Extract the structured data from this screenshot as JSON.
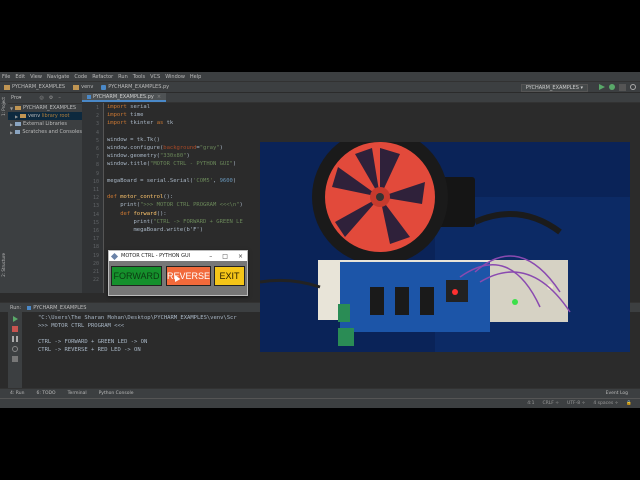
{
  "menu": [
    "File",
    "Edit",
    "View",
    "Navigate",
    "Code",
    "Refactor",
    "Run",
    "Tools",
    "VCS",
    "Window",
    "Help"
  ],
  "navbar": {
    "project": "PYCHARM_EXAMPLES",
    "folder": "venv",
    "file": "PYCHARM_EXAMPLES.py",
    "run_config": "PYCHARM_EXAMPLES"
  },
  "project_panel": {
    "header": "Pro▾",
    "vertical_tabs": [
      "1: Project",
      "2: Structure"
    ],
    "tree": [
      {
        "label": "PYCHARM_EXAMPLES",
        "type": "folder"
      },
      {
        "label": "venv",
        "suffix": "library root",
        "type": "folder"
      },
      {
        "label": "External Libraries",
        "type": "lib"
      },
      {
        "label": "Scratches and Consoles",
        "type": "lib"
      }
    ]
  },
  "editor": {
    "tab_label": "PYCHARM_EXAMPLES.py",
    "line_numbers": [
      "1",
      "2",
      "3",
      "4",
      "5",
      "6",
      "7",
      "8",
      "9",
      "10",
      "11",
      "12",
      "13",
      "14",
      "15",
      "16",
      "17",
      "18",
      "19",
      "20",
      "21",
      "22"
    ],
    "lines": [
      {
        "ln": 1,
        "tokens": [
          [
            "kw",
            "import"
          ],
          [
            "mod",
            " serial"
          ]
        ]
      },
      {
        "ln": 2,
        "tokens": [
          [
            "kw",
            "import"
          ],
          [
            "mod",
            " time"
          ]
        ]
      },
      {
        "ln": 3,
        "tokens": [
          [
            "kw",
            "import"
          ],
          [
            "mod",
            " tkinter "
          ],
          [
            "kw",
            "as"
          ],
          [
            "mod",
            " tk"
          ]
        ]
      },
      {
        "ln": 4,
        "tokens": []
      },
      {
        "ln": 5,
        "tokens": [
          [
            "mod",
            "window = tk.Tk()"
          ]
        ]
      },
      {
        "ln": 6,
        "tokens": [
          [
            "mod",
            "window.configure("
          ],
          [
            "sp",
            "background"
          ],
          [
            "mod",
            "="
          ],
          [
            "str",
            "\"gray\""
          ],
          [
            "mod",
            ")"
          ]
        ]
      },
      {
        "ln": 7,
        "tokens": [
          [
            "mod",
            "window.geometry("
          ],
          [
            "str",
            "\"330x80\""
          ],
          [
            "mod",
            ")"
          ]
        ]
      },
      {
        "ln": 8,
        "tokens": [
          [
            "mod",
            "window.title("
          ],
          [
            "str",
            "\"MOTOR CTRL - PYTHON GUI\""
          ],
          [
            "mod",
            ")"
          ]
        ]
      },
      {
        "ln": 9,
        "tokens": []
      },
      {
        "ln": 10,
        "tokens": [
          [
            "mod",
            "megaBoard = serial.Serial("
          ],
          [
            "str",
            "'COM5'"
          ],
          [
            "mod",
            ", "
          ],
          [
            "num",
            "9600"
          ],
          [
            "mod",
            ")"
          ]
        ]
      },
      {
        "ln": 11,
        "tokens": []
      },
      {
        "ln": 12,
        "tokens": [
          [
            "kw",
            "def "
          ],
          [
            "fn",
            "motor_control"
          ],
          [
            "mod",
            "():"
          ]
        ]
      },
      {
        "ln": 13,
        "tokens": [
          [
            "mod",
            "    print("
          ],
          [
            "str",
            "\">>> MOTOR CTRL PROGRAM <<<\\n\""
          ],
          [
            "mod",
            ")"
          ]
        ]
      },
      {
        "ln": 14,
        "tokens": [
          [
            "kw",
            "    def "
          ],
          [
            "fn",
            "forward"
          ],
          [
            "mod",
            "():"
          ]
        ]
      },
      {
        "ln": 15,
        "tokens": [
          [
            "mod",
            "        print("
          ],
          [
            "str",
            "\"CTRL -> FORWARD + GREEN LE"
          ]
        ]
      },
      {
        "ln": 16,
        "tokens": [
          [
            "mod",
            "        megaBoard.write(b'F')"
          ]
        ]
      },
      {
        "ln": 17,
        "tokens": []
      },
      {
        "ln": 18,
        "tokens": []
      },
      {
        "ln": 19,
        "tokens": []
      },
      {
        "ln": 20,
        "tokens": [
          [
            "mod",
            "            ui()"
          ]
        ]
      },
      {
        "ln": 21,
        "tokens": []
      },
      {
        "ln": 22,
        "tokens": []
      }
    ]
  },
  "run_panel": {
    "header_label": "Run:",
    "config": "PYCHARM_EXAMPLES",
    "console": [
      "\"C:\\Users\\The Sharan Mohan\\Desktop\\PYCHARM_EXAMPLES\\venv\\Scr",
      ">>> MOTOR CTRL PROGRAM <<<",
      "",
      "CTRL -> FORWARD + GREEN LED -> ON",
      "CTRL -> REVERSE + RED LED -> ON"
    ]
  },
  "bottom_tabs": [
    "4: Run",
    "6: TODO",
    "Terminal",
    "Python Console"
  ],
  "event_log": "Event Log",
  "status": [
    "4:1",
    "CRLF ÷",
    "UTF-8 ÷",
    "4 spaces ÷"
  ],
  "tk_window": {
    "title": "MOTOR CTRL - PYTHON GUI",
    "forward": "FORWARD",
    "reverse": "REVERSE",
    "exit": "EXIT"
  },
  "colors": {
    "forward_bg": "#15902c",
    "reverse_bg": "#f26a3b",
    "exit_bg": "#f5c518",
    "ide_bg": "#2b2b2b",
    "wheel": "#e24a3b"
  }
}
